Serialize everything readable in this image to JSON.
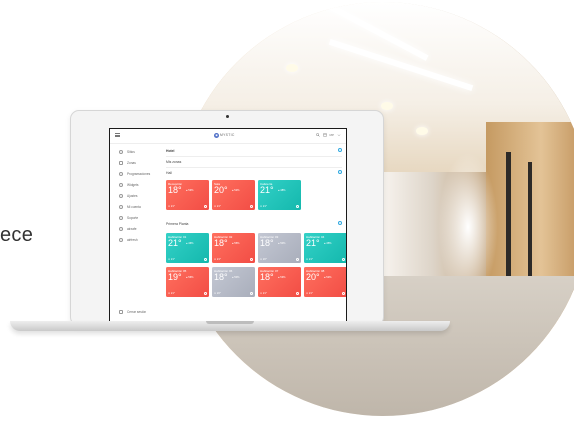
{
  "hero": {
    "side_text": "ece"
  },
  "app": {
    "brand": "MYSTIC",
    "top_right_text": "MP",
    "sidebar": [
      {
        "label": "Sitios",
        "icon": "sites-icon"
      },
      {
        "label": "Zonas",
        "icon": "zones-icon"
      },
      {
        "label": "Programaciones",
        "icon": "schedules-icon"
      },
      {
        "label": "Widgets",
        "icon": "widgets-icon"
      },
      {
        "label": "Ajustes",
        "icon": "settings-icon"
      },
      {
        "label": "Mi cuenta",
        "icon": "account-icon"
      },
      {
        "label": "Soporte",
        "icon": "support-icon"
      },
      {
        "label": "airzafe",
        "icon": "airzafe-icon"
      },
      {
        "label": "airfresh",
        "icon": "airfresh-icon"
      }
    ],
    "logout_label": "Cerrar sesión",
    "site_name": "Hotel",
    "my_zones_label": "Mis zonas",
    "group_hall": "Hall",
    "group_floor": "Primera Planta",
    "hall_tiles": [
      {
        "name": "Recepción",
        "temp": "18°",
        "humidity": "● 53%",
        "setpoint": "⊙ 21°",
        "color": "red"
      },
      {
        "name": "Sala",
        "temp": "20°",
        "humidity": "● 52%",
        "setpoint": "⊙ 21°",
        "color": "red"
      },
      {
        "name": "Cafetería",
        "temp": "21°",
        "humidity": "● 48%",
        "setpoint": "⊙ 21°",
        "color": "teal"
      }
    ],
    "floor_tiles": [
      {
        "name": "Habitación 01",
        "temp": "21°",
        "humidity": "● 46%",
        "setpoint": "⊙ 21°",
        "color": "teal"
      },
      {
        "name": "Habitación 02",
        "temp": "18°",
        "humidity": "● 55%",
        "setpoint": "⊙ 21°",
        "color": "red"
      },
      {
        "name": "Habitación 03",
        "temp": "18°",
        "humidity": "● 50%",
        "setpoint": "⊙ 20°",
        "color": "gray"
      },
      {
        "name": "Habitación 04",
        "temp": "21°",
        "humidity": "● 45%",
        "setpoint": "⊙ 21°",
        "color": "teal"
      },
      {
        "name": "Habitación 05",
        "temp": "19°",
        "humidity": "● 56%",
        "setpoint": "⊙ 21°",
        "color": "red"
      },
      {
        "name": "Habitación 06",
        "temp": "18°",
        "humidity": "● 50%",
        "setpoint": "⊙ 20°",
        "color": "gray"
      },
      {
        "name": "Habitación 07",
        "temp": "18°",
        "humidity": "● 53%",
        "setpoint": "⊙ 21°",
        "color": "red"
      },
      {
        "name": "Habitación 08",
        "temp": "20°",
        "humidity": "● 52%",
        "setpoint": "⊙ 21°",
        "color": "red"
      }
    ]
  }
}
